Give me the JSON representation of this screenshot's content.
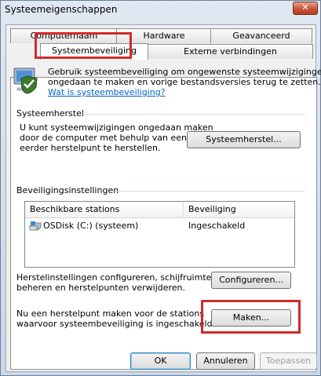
{
  "window": {
    "title": "Systeemeigenschappen",
    "close_glyph": "✕"
  },
  "tabs_row1": [
    "Computernaam",
    "Hardware",
    "Geavanceerd"
  ],
  "tabs_row2": [
    "Systeembeveiliging",
    "Externe verbindingen"
  ],
  "intro": {
    "line1": "Gebruik systeembeveiliging om ongewenste systeemwijzigingen",
    "line2": "ongedaan te maken en vorige bestandsversies terug te zetten.",
    "link": "Wat is systeembeveiliging?",
    "icon": "system-protection-shield-icon"
  },
  "restore": {
    "heading": "Systeemherstel",
    "text1": "U kunt systeemwijzigingen ongedaan maken",
    "text2": "door de computer met behulp van een",
    "text3": "eerder herstelpunt te herstellen.",
    "button": "Systeemherstel..."
  },
  "protection": {
    "heading": "Beveiligingsinstellingen",
    "col_drives": "Beschikbare stations",
    "col_protection": "Beveiliging",
    "rows": [
      {
        "drive": "OSDisk (C:) (systeem)",
        "status": "Ingeschakeld",
        "icon": "hard-disk-icon"
      }
    ]
  },
  "configure": {
    "text1": "Herstelinstellingen configureren, schijfruimte",
    "text2": "beheren en herstelpunten verwijderen.",
    "button": "Configureren..."
  },
  "create": {
    "text1": "Nu een herstelpunt maken voor de stations",
    "text2": "waarvoor systeembeveiliging is ingeschakeld.",
    "button": "Maken..."
  },
  "footer": {
    "ok": "OK",
    "cancel": "Annuleren",
    "apply": "Toepassen"
  },
  "colors": {
    "highlight": "#d22b2b",
    "link": "#0066cc"
  }
}
